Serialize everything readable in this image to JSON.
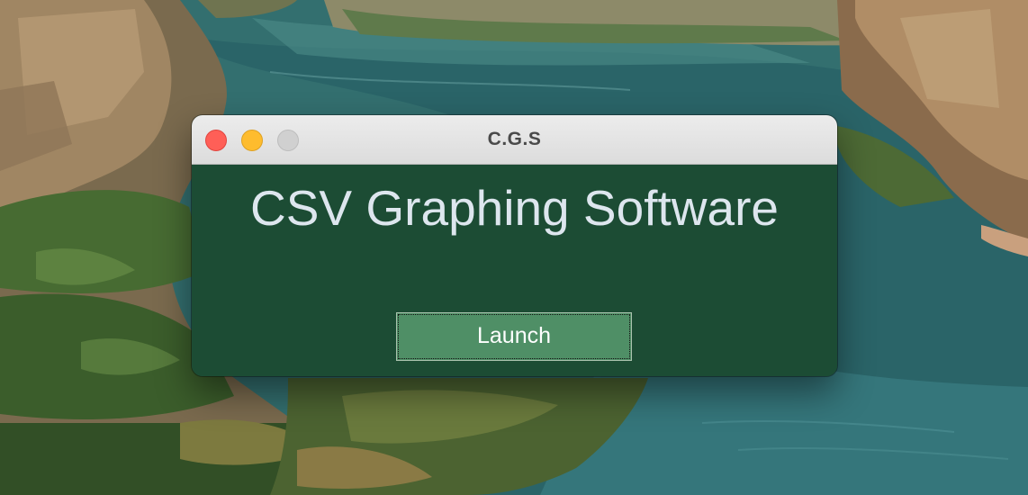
{
  "window": {
    "title": "C.G.S"
  },
  "main": {
    "heading": "CSV Graphing Software",
    "launch_label": "Launch"
  },
  "colors": {
    "window_background": "#1c4c34",
    "heading_text": "#dde6ee",
    "button_background": "#4f8f66",
    "button_text": "#ffffff",
    "close_button": "#ff5f57",
    "minimize_button": "#febc2e",
    "zoom_button_disabled": "#d0d0d0"
  },
  "icons": {
    "close": "close-traffic-light-icon",
    "minimize": "minimize-traffic-light-icon",
    "zoom": "zoom-traffic-light-icon"
  }
}
